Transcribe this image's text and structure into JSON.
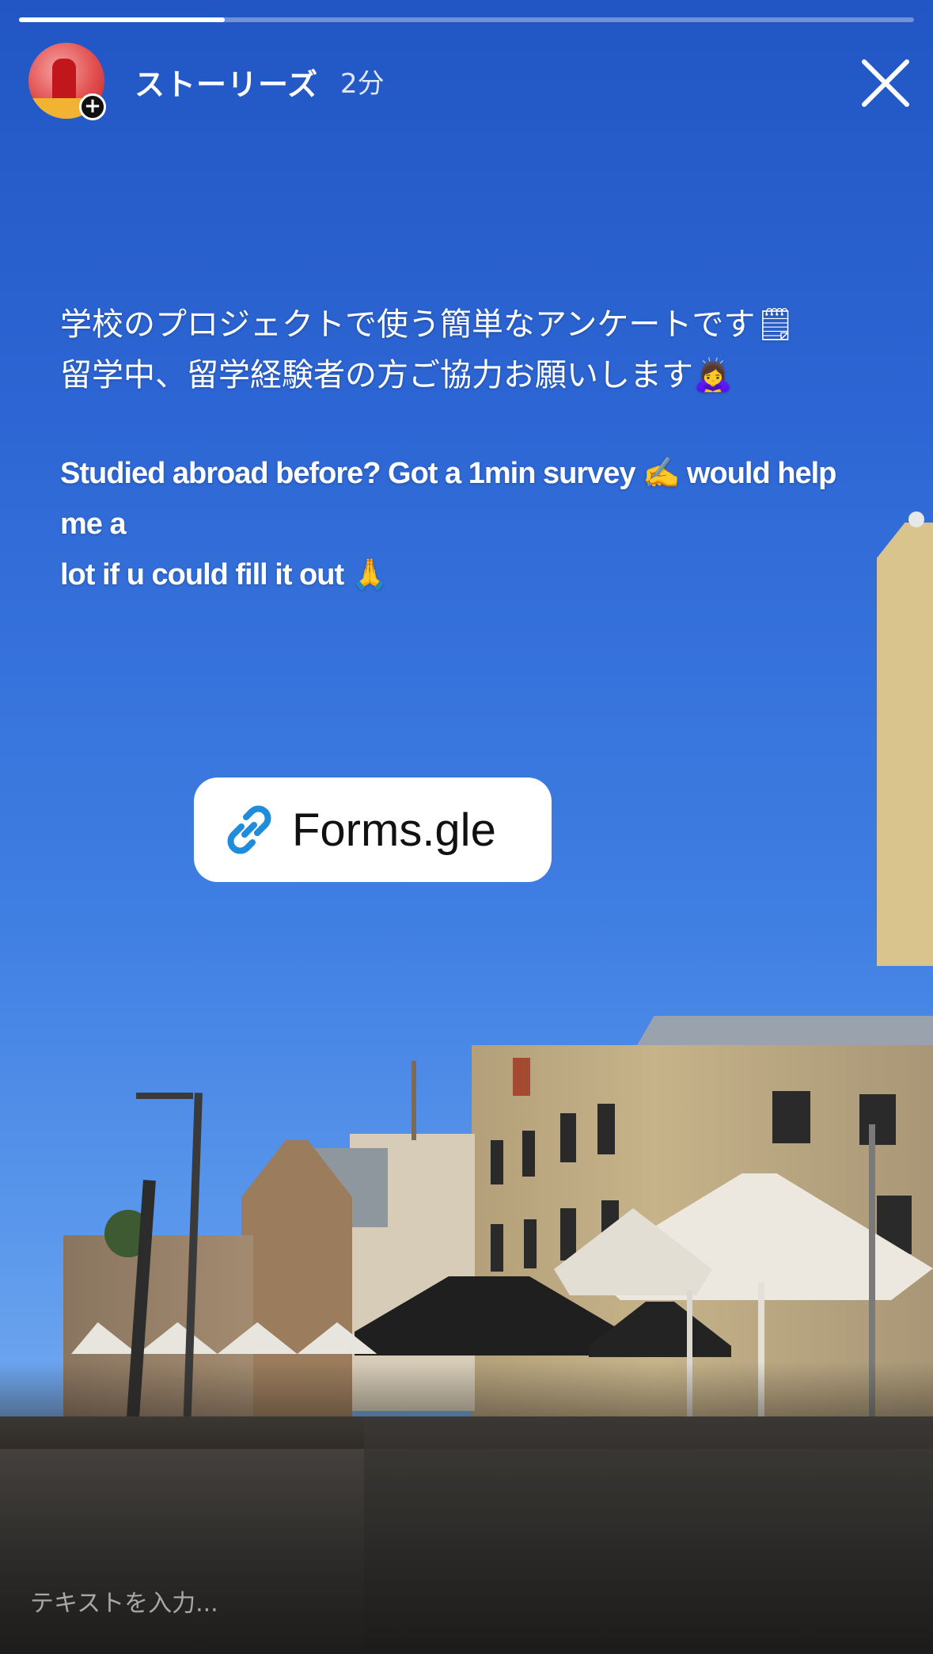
{
  "story": {
    "progress_fraction": 0.23,
    "username": "ストーリーズ",
    "time": "2分",
    "caption_ja_line1": "学校のプロジェクトで使う簡単なアンケートです🗒",
    "caption_ja_line2": "留学中、留学経験者の方ご協力お願いします🙇‍♀️",
    "caption_en_line1": "Studied abroad before? Got a 1min survey ✍️   would help me a",
    "caption_en_line2": "lot if u could fill it out 🙏",
    "link_label": "Forms.gle",
    "input_placeholder": "テキストを入力..."
  },
  "icons": {
    "add": "plus-circle-icon",
    "close": "close-icon",
    "link": "link-icon"
  },
  "colors": {
    "link_icon": "#1f8ddb",
    "sky_top": "#2156c4"
  }
}
